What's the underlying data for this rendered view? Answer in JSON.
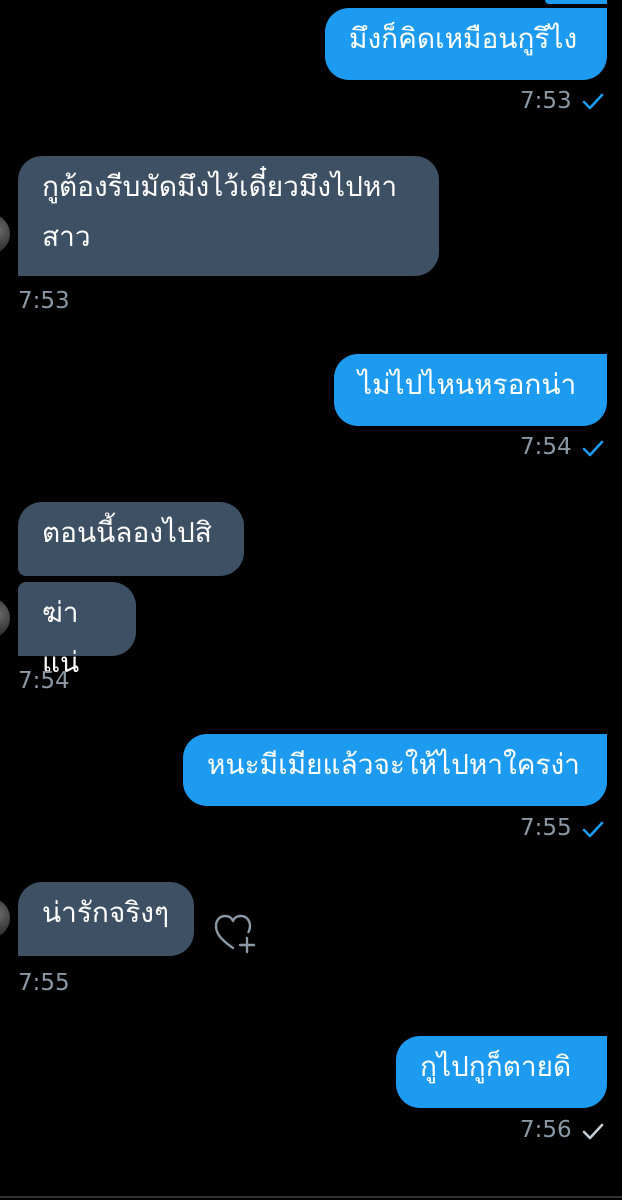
{
  "messages": [
    {
      "direction": "outgoing",
      "text": "มึงก็คิดเหมือนกูรึไง",
      "time": "7:53",
      "status": "read"
    },
    {
      "direction": "incoming",
      "text_line1": "กูต้องรีบมัดมึงไว้เดี๋ยวมึงไปหา",
      "text_line2": "สาว",
      "time": "7:53"
    },
    {
      "direction": "outgoing",
      "text": "ไม่ไปไหนหรอกน่า",
      "time": "7:54",
      "status": "read"
    },
    {
      "direction": "incoming",
      "text": "ตอนนี้ลองไปสิ"
    },
    {
      "direction": "incoming",
      "text": "ฆ่าแน่",
      "time": "7:54"
    },
    {
      "direction": "outgoing",
      "text": "หนะมีเมียแล้วจะให้ไปหาใครง่า",
      "time": "7:55",
      "status": "read"
    },
    {
      "direction": "incoming",
      "text": "น่ารักจริงๆ",
      "time": "7:55",
      "reaction_icon": "heart-plus-icon"
    },
    {
      "direction": "outgoing",
      "text": "กูไปกูก็ตายดิ",
      "time": "7:56",
      "status": "sent"
    }
  ],
  "colors": {
    "background": "#000000",
    "outgoing_bubble": "#1d9bf0",
    "incoming_bubble": "#3e5063",
    "timestamp": "#8b98a5",
    "read_check": "#1d9bf0",
    "sent_check": "#8b98a5"
  }
}
